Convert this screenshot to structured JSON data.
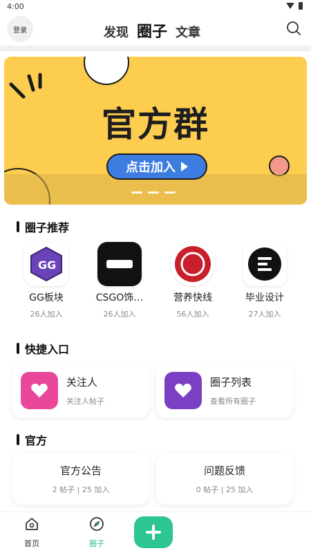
{
  "status_bar": {
    "time": "4:00"
  },
  "header": {
    "login_label": "登录",
    "tabs": [
      {
        "label": "发现",
        "active": false
      },
      {
        "label": "圈子",
        "active": true
      },
      {
        "label": "文章",
        "active": false
      }
    ],
    "search_icon": "search-icon"
  },
  "banner": {
    "title": "官方群",
    "button_label": "点击加入",
    "slide_count": 3,
    "colors": {
      "background": "#fccd4f",
      "button": "#3d7de0"
    }
  },
  "circles": {
    "title": "圈子推荐",
    "items": [
      {
        "name": "GG板块",
        "count": "26人加入",
        "icon": "gg-logo"
      },
      {
        "name": "CSGO饰…",
        "count": "26人加入",
        "icon": "csgo-logo"
      },
      {
        "name": "营养快线",
        "count": "56人加入",
        "icon": "nutrition-logo"
      },
      {
        "name": "毕业设计",
        "count": "27人加入",
        "icon": "menu-logo"
      }
    ]
  },
  "quick_entry": {
    "title": "快捷入口",
    "items": [
      {
        "title": "关注人",
        "subtitle": "关注人帖子",
        "icon": "heart-icon",
        "color": "#e8479a"
      },
      {
        "title": "圈子列表",
        "subtitle": "查看所有圈子",
        "icon": "heart-icon",
        "color": "#7b3fc4"
      }
    ]
  },
  "official": {
    "title": "官方",
    "items": [
      {
        "title": "官方公告",
        "stats": "2 帖子 | 25 加入"
      },
      {
        "title": "问题反馈",
        "stats": "0 帖子 | 25 加入"
      }
    ]
  },
  "bottom_nav": {
    "items": [
      {
        "label": "首页",
        "icon": "home-icon",
        "active": false
      },
      {
        "label": "圈子",
        "icon": "compass-icon",
        "active": true
      }
    ],
    "fab_icon": "plus-icon",
    "accent": "#2ec594"
  }
}
